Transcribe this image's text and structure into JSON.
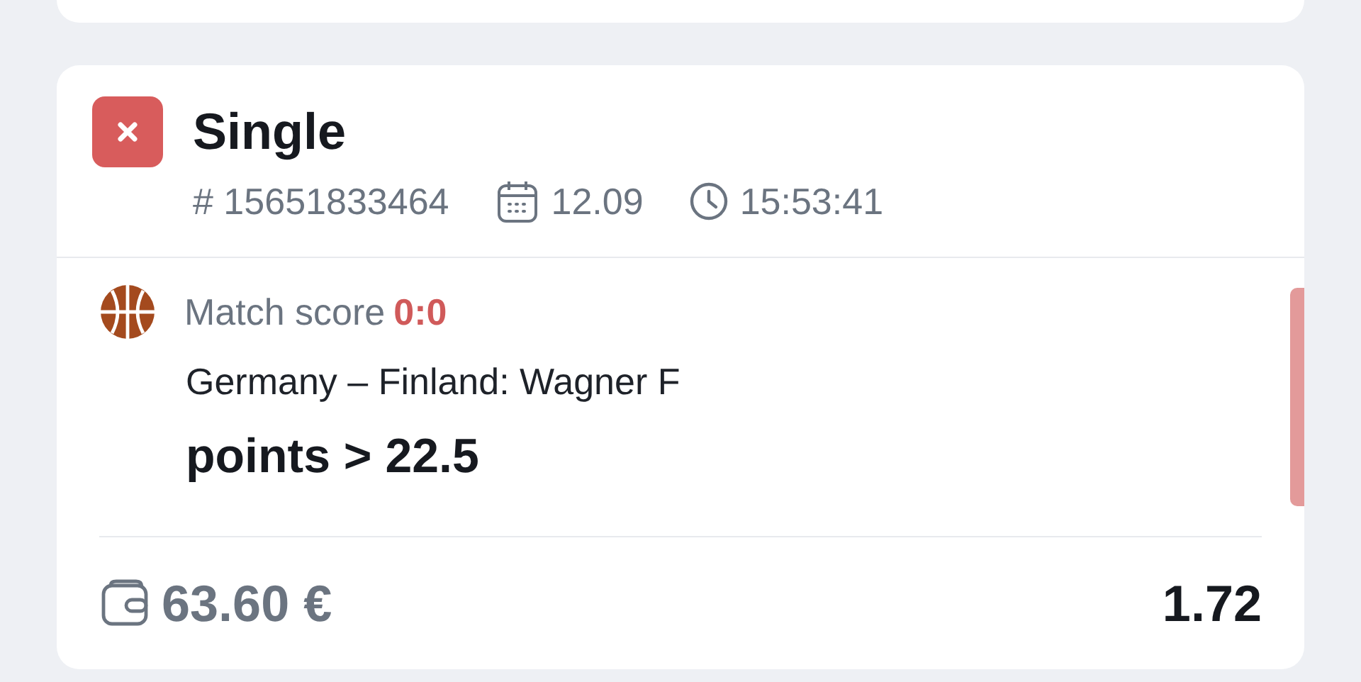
{
  "bet": {
    "type": "Single",
    "kind": "lost",
    "number": "# 15651833464",
    "date": "12.09",
    "time": "15:53:41",
    "selections": [
      {
        "kind": "basketball",
        "label": "Match score",
        "score": "0:0",
        "event": "Germany – Finland: Wagner F",
        "market": "points > 22.5"
      }
    ],
    "stake": "63.60 €",
    "odds": "1.72"
  }
}
